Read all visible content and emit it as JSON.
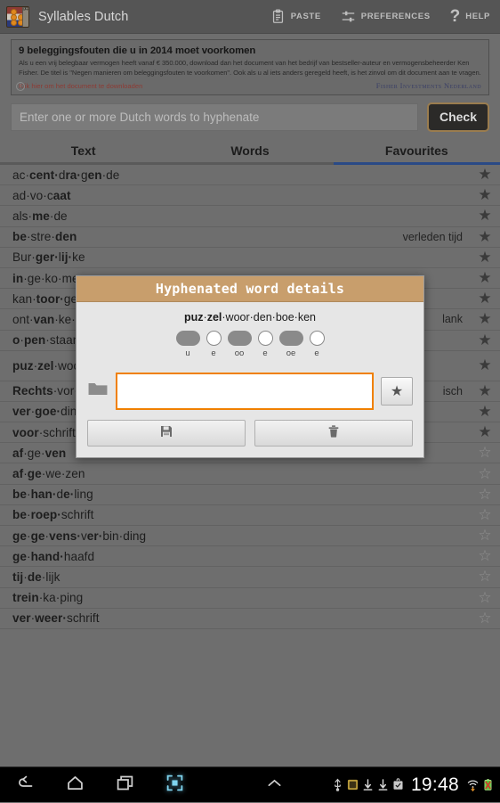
{
  "app": {
    "title": "Syllables Dutch",
    "icon": "dutch-flag-syllables-icon"
  },
  "actionbar": {
    "paste_label": "PASTE",
    "preferences_label": "PREFERENCES",
    "help_label": "HELP",
    "help_glyph": "?"
  },
  "ad": {
    "headline": "9 beleggingsfouten die u in 2014 moet voorkomen",
    "body": "Als u een vrij belegbaar vermogen heeft vanaf € 350.000, download dan het document van het bedrijf van bestseller-auteur en vermogensbeheerder Ken Fisher. De titel is \"Negen manieren om beleggingsfouten te voorkomen\". Ook als u al iets anders geregeld heeft, is het zinvol om dit document aan te vragen.",
    "link": "Klik hier om het document te downloaden",
    "brand": "Fisher Investments Nederland",
    "brand_tm": "™",
    "info_glyph": "i"
  },
  "search": {
    "value": "",
    "placeholder": "Enter one or more Dutch words to hyphenate",
    "check_label": "Check"
  },
  "tabs": [
    {
      "label": "Text",
      "selected": false
    },
    {
      "label": "Words",
      "selected": false
    },
    {
      "label": "Favourites",
      "selected": true
    }
  ],
  "list": {
    "rows": [
      {
        "word": "ac·cent·dra·gen·de",
        "note": "",
        "favourite": true,
        "selected": false
      },
      {
        "word": "ad·vo·caat",
        "note": "",
        "favourite": true,
        "selected": false
      },
      {
        "word": "als·me·de",
        "note": "",
        "favourite": true,
        "selected": false
      },
      {
        "word": "be·stre·den",
        "note": "verleden tijd",
        "favourite": true,
        "selected": false
      },
      {
        "word": "Bur·ger·lij·ke",
        "note": "",
        "favourite": true,
        "selected": false
      },
      {
        "word": "in·ge·ko·men",
        "note": "",
        "favourite": true,
        "selected": false
      },
      {
        "word": "kan·toor·ge·bouw",
        "note": "",
        "favourite": true,
        "selected": false
      },
      {
        "word": "ont·van·ke·lijk",
        "note": "lank",
        "favourite": true,
        "selected": false
      },
      {
        "word": "o·pen·staan·de",
        "note": "",
        "favourite": true,
        "selected": false
      },
      {
        "word": "puz·zel·woor·den·boe·ken",
        "note": "",
        "favourite": true,
        "selected": true
      },
      {
        "word": "Rechts·vor·de·ring",
        "note": "isch",
        "favourite": true,
        "selected": false
      },
      {
        "word": "ver·goe·ding",
        "note": "",
        "favourite": true,
        "selected": false
      },
      {
        "word": "voor·schrift",
        "note": "",
        "favourite": true,
        "selected": false
      },
      {
        "word": "af·ge·ven",
        "note": "",
        "favourite": false,
        "selected": false
      },
      {
        "word": "af·ge·we·zen",
        "note": "",
        "favourite": false,
        "selected": false
      },
      {
        "word": "be·han·de·ling",
        "note": "",
        "favourite": false,
        "selected": false
      },
      {
        "word": "be·roep·schrift",
        "note": "",
        "favourite": false,
        "selected": false
      },
      {
        "word": "ge·ge·vens·ver·bin·ding",
        "note": "",
        "favourite": false,
        "selected": false
      },
      {
        "word": "ge·hand·haafd",
        "note": "",
        "favourite": false,
        "selected": false
      },
      {
        "word": "tij·de·lijk",
        "note": "",
        "favourite": false,
        "selected": false
      },
      {
        "word": "trein·ka·ping",
        "note": "",
        "favourite": false,
        "selected": false
      },
      {
        "word": "ver·weer·schrift",
        "note": "",
        "favourite": false,
        "selected": false
      }
    ],
    "star_filled_glyph": "★",
    "star_empty_glyph": "☆"
  },
  "dialog": {
    "title": "Hyphenated word details",
    "word": "puz·zel·woor·den·boe·ken",
    "vowels": [
      {
        "label": "u",
        "length": "long"
      },
      {
        "label": "e",
        "length": "short"
      },
      {
        "label": "oo",
        "length": "long"
      },
      {
        "label": "e",
        "length": "short"
      },
      {
        "label": "oe",
        "length": "long"
      },
      {
        "label": "e",
        "length": "short"
      }
    ],
    "note_value": "",
    "note_placeholder": "",
    "folder_icon": "folder-icon",
    "favourite_icon": "star-icon",
    "save_icon": "save-icon",
    "delete_icon": "trash-icon"
  },
  "navbar": {
    "back_icon": "back-icon",
    "home_icon": "home-icon",
    "recents_icon": "recents-icon",
    "screenshot_icon": "screenshot-icon",
    "expand_icon": "chevron-up-icon",
    "clock": "19:48",
    "status_icons": [
      "usb-icon",
      "bug-icon",
      "download-icon",
      "download-icon",
      "bag-check-icon",
      "wifi-icon",
      "battery-icon"
    ]
  },
  "colors": {
    "accent_tan": "#c89e6c",
    "input_orange": "#f08000",
    "tab_selected": "#2a4a86",
    "chrome_grey": "#6e6e6e"
  }
}
